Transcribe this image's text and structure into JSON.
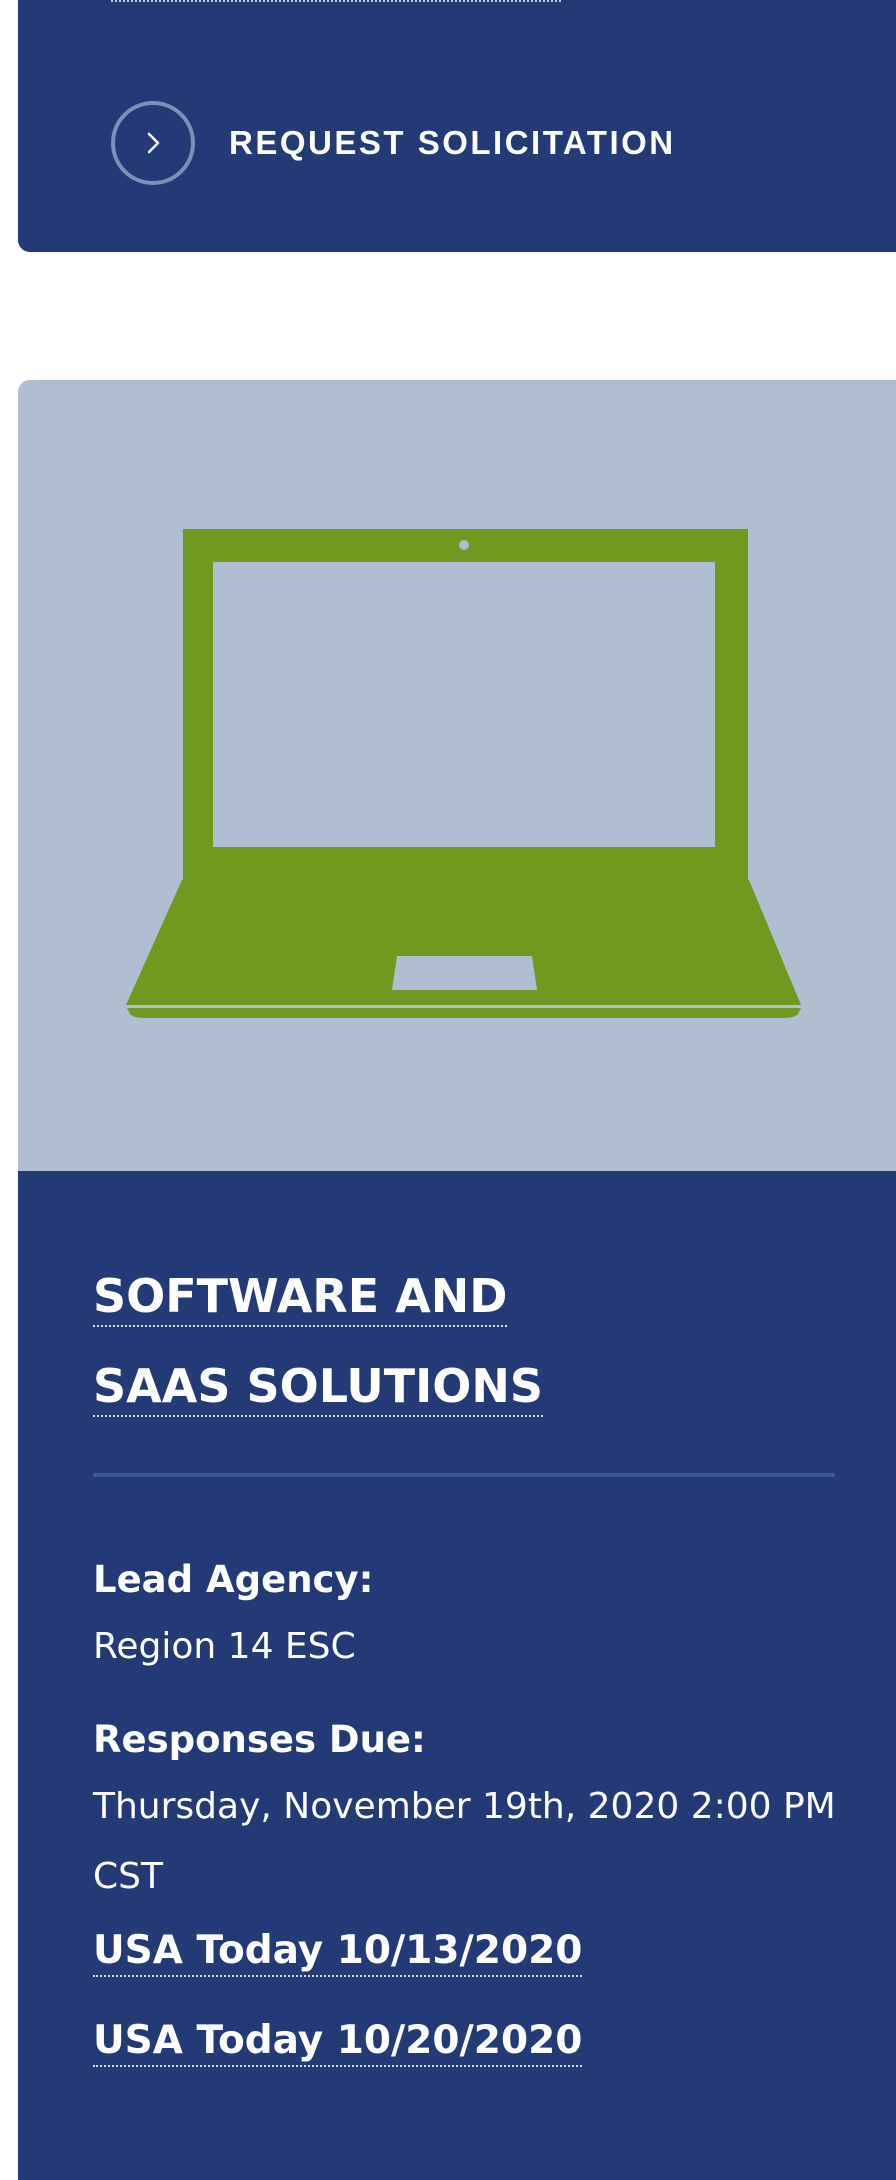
{
  "top_card": {
    "request_button_label": "REQUEST SOLICITATION",
    "request_icon": "chevron-right-icon"
  },
  "card": {
    "image_icon": "laptop-icon",
    "colors": {
      "card_background": "#243a76",
      "image_background": "#b1bdd0",
      "laptop": "#709920"
    },
    "title": "SOFTWARE AND SAAS SOLUTIONS",
    "lead_agency_label": "Lead Agency:",
    "lead_agency_value": "Region 14 ESC",
    "responses_due_label": "Responses Due:",
    "responses_due_value": "Thursday, November 19th, 2020 2:00 PM CST",
    "links": [
      "USA Today 10/13/2020",
      "USA Today 10/20/2020"
    ]
  }
}
